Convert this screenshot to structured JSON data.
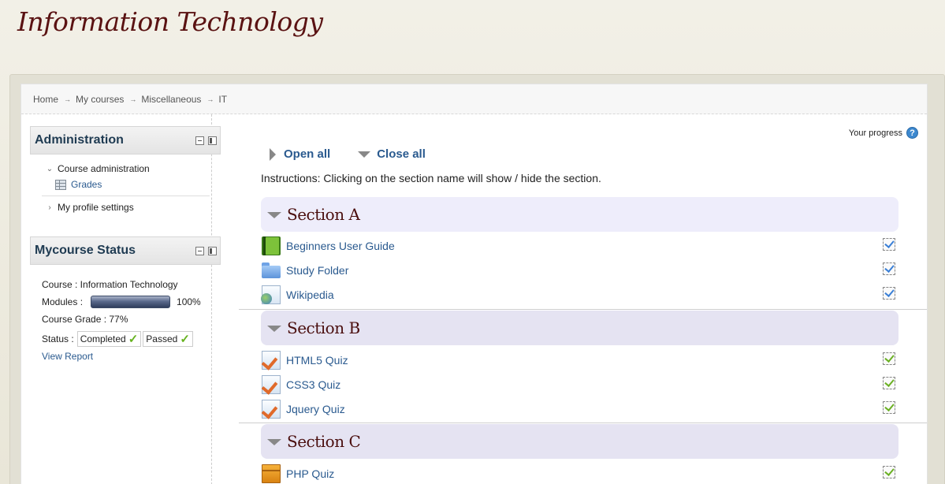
{
  "site": {
    "title": "Information Technology"
  },
  "breadcrumb": [
    "Home",
    "My courses",
    "Miscellaneous",
    "IT"
  ],
  "breadcrumb_separator": "→",
  "administration": {
    "title": "Administration",
    "course_admin": "Course administration",
    "grades": "Grades",
    "profile_settings": "My profile settings"
  },
  "mycourse": {
    "title": "Mycourse Status",
    "course_line": "Course : Information Technology",
    "modules_label": "Modules :",
    "modules_progress": 1.0,
    "modules_percent": "100%",
    "grade_line": "Course Grade : 77%",
    "status_label": "Status :",
    "status_completed": "Completed",
    "status_passed": "Passed",
    "view_report": "View Report"
  },
  "main": {
    "progress_label": "Your progress",
    "help_icon": "?",
    "open_all": "Open all",
    "close_all": "Close all",
    "instructions": "Instructions: Clicking on the section name will show / hide the section."
  },
  "sections": [
    {
      "title": "Section A",
      "activities": [
        {
          "label": "Beginners User Guide",
          "icon": "book-icon",
          "check_color": "#3a7fd6"
        },
        {
          "label": "Study Folder",
          "icon": "folder-icon",
          "check_color": "#3a7fd6"
        },
        {
          "label": "Wikipedia",
          "icon": "url-icon",
          "check_color": "#3a7fd6"
        }
      ]
    },
    {
      "title": "Section B",
      "activities": [
        {
          "label": "HTML5 Quiz",
          "icon": "quiz-icon",
          "check_color": "#6ab023"
        },
        {
          "label": "CSS3 Quiz",
          "icon": "quiz-icon",
          "check_color": "#6ab023"
        },
        {
          "label": "Jquery Quiz",
          "icon": "quiz-icon",
          "check_color": "#6ab023"
        }
      ]
    },
    {
      "title": "Section C",
      "activities": [
        {
          "label": "PHP Quiz",
          "icon": "package-icon",
          "check_color": "#6ab023"
        }
      ]
    }
  ],
  "colors": {
    "title": "#5a1212",
    "link": "#2a5a8f",
    "section_bg": "#e5e3f2"
  }
}
